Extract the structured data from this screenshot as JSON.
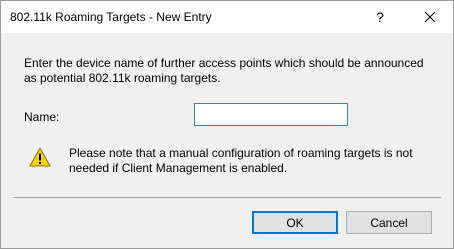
{
  "window": {
    "title": "802.11k Roaming Targets - New Entry",
    "help_glyph": "?",
    "close_icon": "close-icon"
  },
  "form": {
    "description": "Enter the device name of further access points which should be announced as potential 802.11k roaming targets.",
    "name_label": "Name:",
    "name_value": "",
    "name_placeholder": ""
  },
  "warning": {
    "icon": "warning-icon",
    "text": "Please note that a manual configuration of roaming targets is not needed if Client Management is enabled."
  },
  "buttons": {
    "ok_label": "OK",
    "cancel_label": "Cancel"
  },
  "colors": {
    "accent": "#0078d7",
    "warning_fill": "#f5d211"
  }
}
